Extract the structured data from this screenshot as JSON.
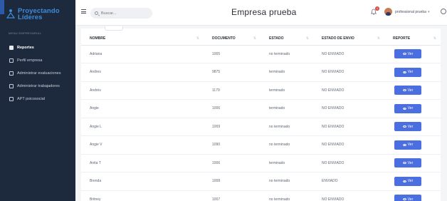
{
  "sidebar": {
    "brand_line1": "Proyectando",
    "brand_line2": "Líderes",
    "section_label": "MENU EMPRESARIAL",
    "items": [
      {
        "label": "Reportes",
        "active": true
      },
      {
        "label": "Perfil empresa",
        "active": false
      },
      {
        "label": "Administrar evaluaciones",
        "active": false
      },
      {
        "label": "Administrar trabajadores",
        "active": false
      },
      {
        "label": "APT psicosocial",
        "active": false
      }
    ]
  },
  "header": {
    "search_placeholder": "Buscar...",
    "title": "Empresa prueba",
    "notification_count": "1",
    "user_name": "professional prueba",
    "user_chevron": "▾"
  },
  "table": {
    "columns": [
      "NOMBRE",
      "DOCUMENTO",
      "ESTADO",
      "ESTADO DE ENVIO",
      "REPORTE"
    ],
    "sort_glyph": "⇅",
    "button_label": "Ver",
    "rows": [
      {
        "nombre": "Adriana",
        "documento": "1005",
        "estado": "no terminado",
        "envio": "NO ENVIADO"
      },
      {
        "nombre": "Andres",
        "documento": "9875",
        "estado": "terminado",
        "envio": "NO ENVIADO"
      },
      {
        "nombre": "Andrés",
        "documento": "1179",
        "estado": "terminado",
        "envio": "NO ENVIADO"
      },
      {
        "nombre": "Angie",
        "documento": "1006",
        "estado": "terminado",
        "envio": "NO ENVIADO"
      },
      {
        "nombre": "Angie L",
        "documento": "1009",
        "estado": "no terminado",
        "envio": "NO ENVIADO"
      },
      {
        "nombre": "Angie V",
        "documento": "1090",
        "estado": "no terminado",
        "envio": "NO ENVIADO"
      },
      {
        "nombre": "Anita T",
        "documento": "1006",
        "estado": "terminado",
        "envio": "NO ENVIADO"
      },
      {
        "nombre": "Brenda",
        "documento": "1008",
        "estado": "no terminado",
        "envio": "ENVIADO"
      },
      {
        "nombre": "Britney",
        "documento": "1007",
        "estado": "no terminado",
        "envio": "NO ENVIADO"
      }
    ]
  },
  "colors": {
    "sidebar_bg": "#1d2a3d",
    "brand": "#3e8bdc",
    "button": "#4b6fe0",
    "badge": "#e0483e"
  }
}
